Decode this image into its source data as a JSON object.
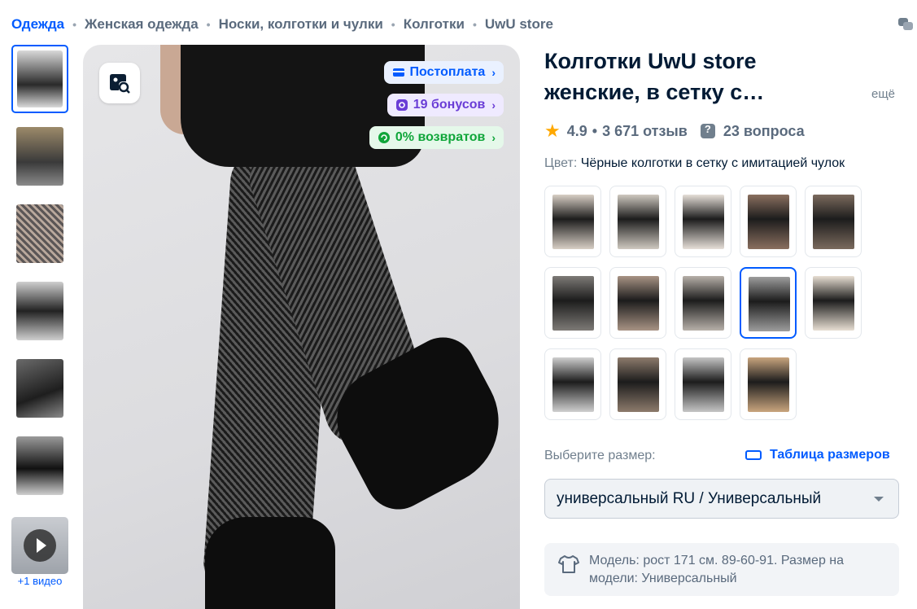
{
  "breadcrumb": [
    "Одежда",
    "Женская одежда",
    "Носки, колготки и чулки",
    "Колготки",
    "UwU store"
  ],
  "gallery": {
    "thumb_colors": [
      "#d9d9d9",
      "#9c8a6a",
      "#5b5656",
      "#cfcfcf",
      "#6a6a6a",
      "#9a9a9a"
    ],
    "video_label": "+1 видео"
  },
  "badges": {
    "postpay": "Постоплата",
    "bonus": "19 бонусов",
    "returns": "0% возвратов"
  },
  "product": {
    "title": "Колготки UwU store женские, в сетку с…",
    "more": "ещё",
    "rating": "4.9",
    "reviews": "3 671 отзыв",
    "questions": "23 вопроса",
    "color_label": "Цвет:",
    "color_value": "Чёрные колготки в сетку с имитацией чулок"
  },
  "swatch_colors": [
    "#d8cfc5",
    "#cfc9c0",
    "#e6dfd8",
    "#8a6f5f",
    "#7b6a5d",
    "#7d7a76",
    "#a89384",
    "#b7b0a9",
    "#9d9d9d",
    "#e7ded2",
    "#cfcfcf",
    "#8d7b6c",
    "#c5c5c5",
    "#c9a57e"
  ],
  "accent_color": "#005bff",
  "size": {
    "label": "Выберите размер:",
    "table_link": "Таблица размеров",
    "selected": "универсальный RU / Универсальный"
  },
  "model_info": "Модель: рост 171 см. 89-60-91. Размер на модели: Универсальный"
}
